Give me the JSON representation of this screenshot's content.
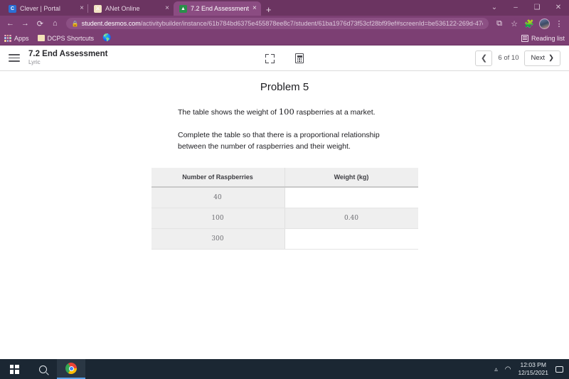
{
  "browser": {
    "tabs": [
      {
        "title": "Clever | Portal",
        "favicon": "clever-icon",
        "active": false,
        "close": "×"
      },
      {
        "title": "ANet Online",
        "favicon": "anet-icon",
        "active": false,
        "close": "×"
      },
      {
        "title": "7.2 End Assessment",
        "favicon": "desmos-icon",
        "active": true,
        "close": "×"
      }
    ],
    "new_tab_label": "+",
    "window_controls": {
      "minimize_alt": "⌄",
      "minimize": "–",
      "maximize": "❑",
      "close": "✕"
    },
    "nav": {
      "back": "←",
      "forward": "→",
      "reload": "⟳",
      "home": "⌂"
    },
    "omnibox": {
      "lock_icon": "lock-icon",
      "url_domain": "student.desmos.com",
      "url_path": "/activitybuilder/instance/61b784bd6375e455878ee8c7/student/61ba1976d73f53cf28bf99ef#screenId=be536122-269d-47e6-a6...",
      "share_icon": "share-icon",
      "bookmark_icon": "star-icon"
    },
    "toolbar": {
      "extensions_icon": "puzzle-icon",
      "profile_icon": "avatar-icon",
      "menu_icon": "kebab-menu-icon"
    },
    "bookmarks": [
      {
        "label": "Apps",
        "icon": "apps-grid-icon"
      },
      {
        "label": "DCPS Shortcuts",
        "icon": "folder-icon"
      },
      {
        "label": "",
        "icon": "globe-icon"
      }
    ],
    "reading_list": {
      "label": "Reading list",
      "icon": "reading-list-icon"
    }
  },
  "app": {
    "menu_icon": "hamburger-menu-icon",
    "title": "7.2 End Assessment",
    "subtitle": "Lyric",
    "tools": [
      {
        "name": "expand-icon",
        "label": ""
      },
      {
        "name": "calculator-icon",
        "label": ""
      }
    ],
    "nav": {
      "prev_icon": "❮",
      "page_indicator": "6 of 10",
      "next_label": "Next",
      "next_icon": "❯"
    }
  },
  "problem": {
    "title": "Problem 5",
    "paragraph1_before": "The table shows the weight of ",
    "paragraph1_number": "100",
    "paragraph1_after": " raspberries at a market.",
    "paragraph2": "Complete the table so that there is a proportional relationship between the number of raspberries and their weight.",
    "table": {
      "headers": [
        "Number of Raspberries",
        "Weight (kg)"
      ],
      "rows": [
        {
          "count": "40",
          "weight": "",
          "weight_filled": false
        },
        {
          "count": "100",
          "weight": "0.40",
          "weight_filled": true
        },
        {
          "count": "300",
          "weight": "",
          "weight_filled": false
        }
      ]
    }
  },
  "taskbar": {
    "start_icon": "windows-start-icon",
    "search_icon": "search-icon",
    "chrome_icon": "chrome-icon",
    "tray": {
      "chevron_icon": "chevron-up-icon",
      "network_icon": "wifi-icon",
      "time": "12:03 PM",
      "date": "12/15/2021",
      "notification_icon": "notification-icon"
    }
  }
}
